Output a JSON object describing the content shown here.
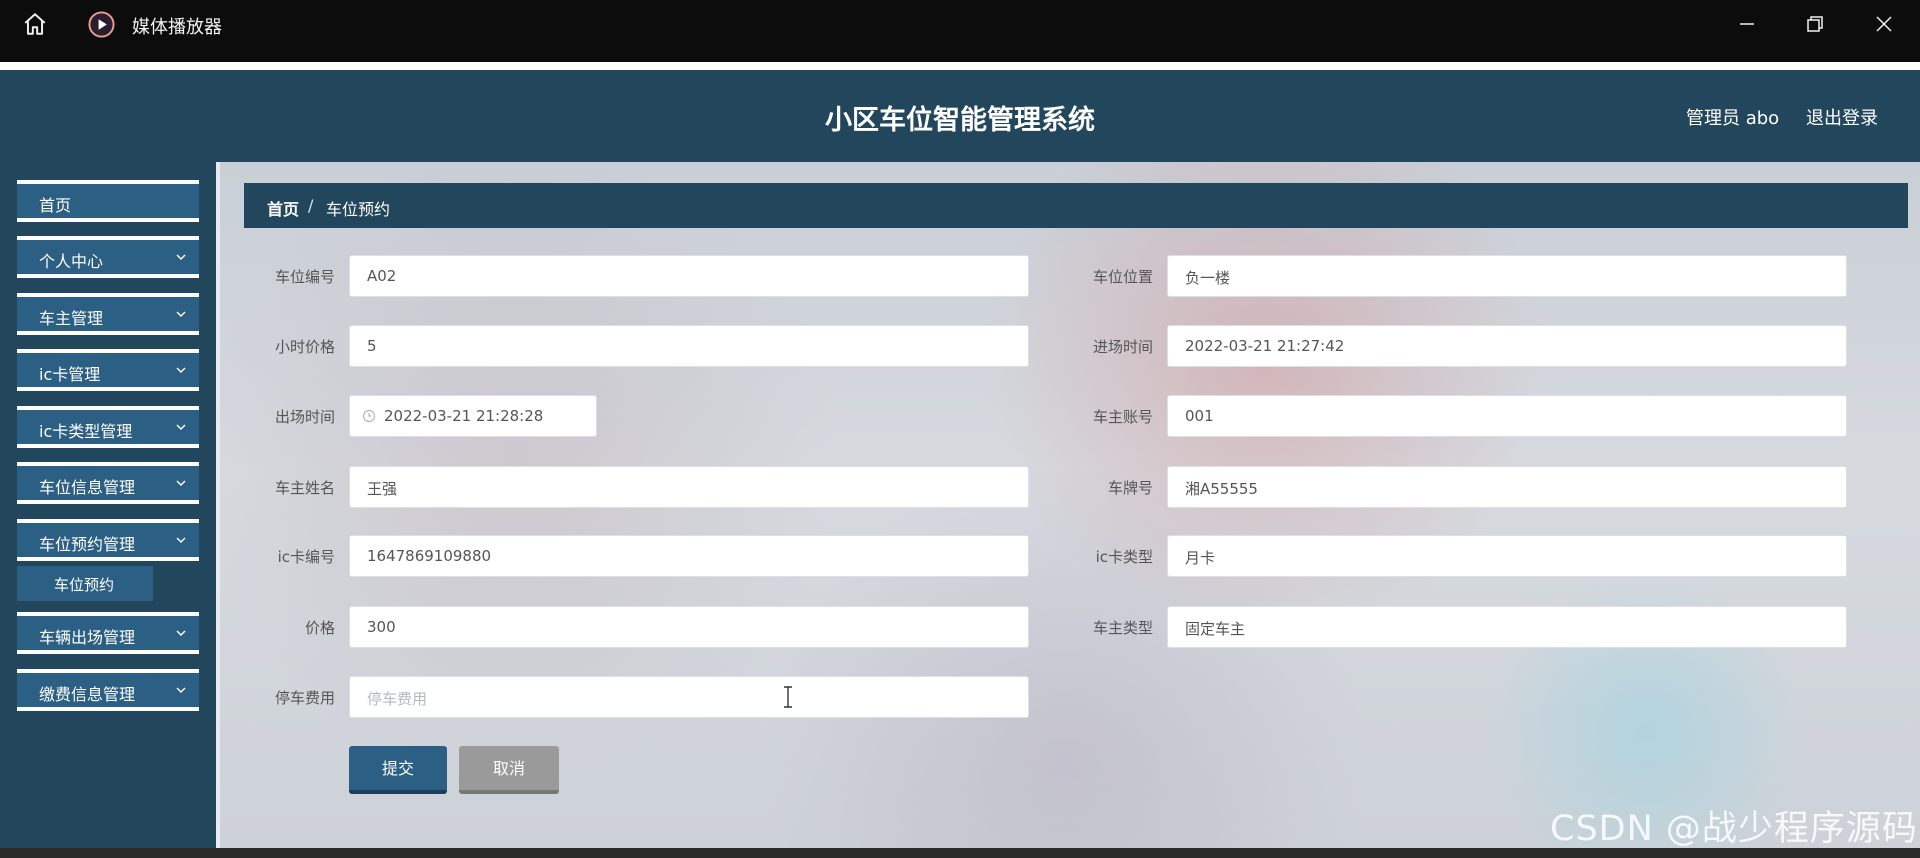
{
  "window": {
    "title": "媒体播放器",
    "icons": {
      "home": "home-icon",
      "app": "media-player-icon",
      "minimize": "minimize-icon",
      "maximize": "restore-icon",
      "close": "close-icon"
    }
  },
  "header": {
    "title": "小区车位智能管理系统",
    "admin": "管理员 abo",
    "logout": "退出登录"
  },
  "sidebar": {
    "items": [
      {
        "label": "首页"
      },
      {
        "label": "个人中心"
      },
      {
        "label": "车主管理"
      },
      {
        "label": "ic卡管理"
      },
      {
        "label": "ic卡类型管理"
      },
      {
        "label": "车位信息管理"
      },
      {
        "label": "车位预约管理"
      },
      {
        "label": "车辆出场管理"
      },
      {
        "label": "缴费信息管理"
      }
    ],
    "sub_item": "车位预约"
  },
  "breadcrumb": {
    "home": "首页",
    "separator": "/",
    "current": "车位预约"
  },
  "form": {
    "fields": [
      {
        "label": "车位编号",
        "value": "A02"
      },
      {
        "label": "车位位置",
        "value": "负一楼"
      },
      {
        "label": "小时价格",
        "value": "5"
      },
      {
        "label": "进场时间",
        "value": "2022-03-21 21:27:42"
      },
      {
        "label": "出场时间",
        "value": "2022-03-21 21:28:28"
      },
      {
        "label": "车主账号",
        "value": "001"
      },
      {
        "label": "车主姓名",
        "value": "王强"
      },
      {
        "label": "车牌号",
        "value": "湘A55555"
      },
      {
        "label": "ic卡编号",
        "value": "1647869109880"
      },
      {
        "label": "ic卡类型",
        "value": "月卡"
      },
      {
        "label": "价格",
        "value": "300"
      },
      {
        "label": "车主类型",
        "value": "固定车主"
      },
      {
        "label": "停车费用",
        "placeholder": "停车费用",
        "value": ""
      }
    ],
    "submit": "提交",
    "cancel": "取消"
  },
  "watermark": "CSDN @战少程序源码",
  "colors": {
    "header_bg": "#22465c",
    "accent": "#2b5f84",
    "cancel": "#9a9a9a"
  }
}
